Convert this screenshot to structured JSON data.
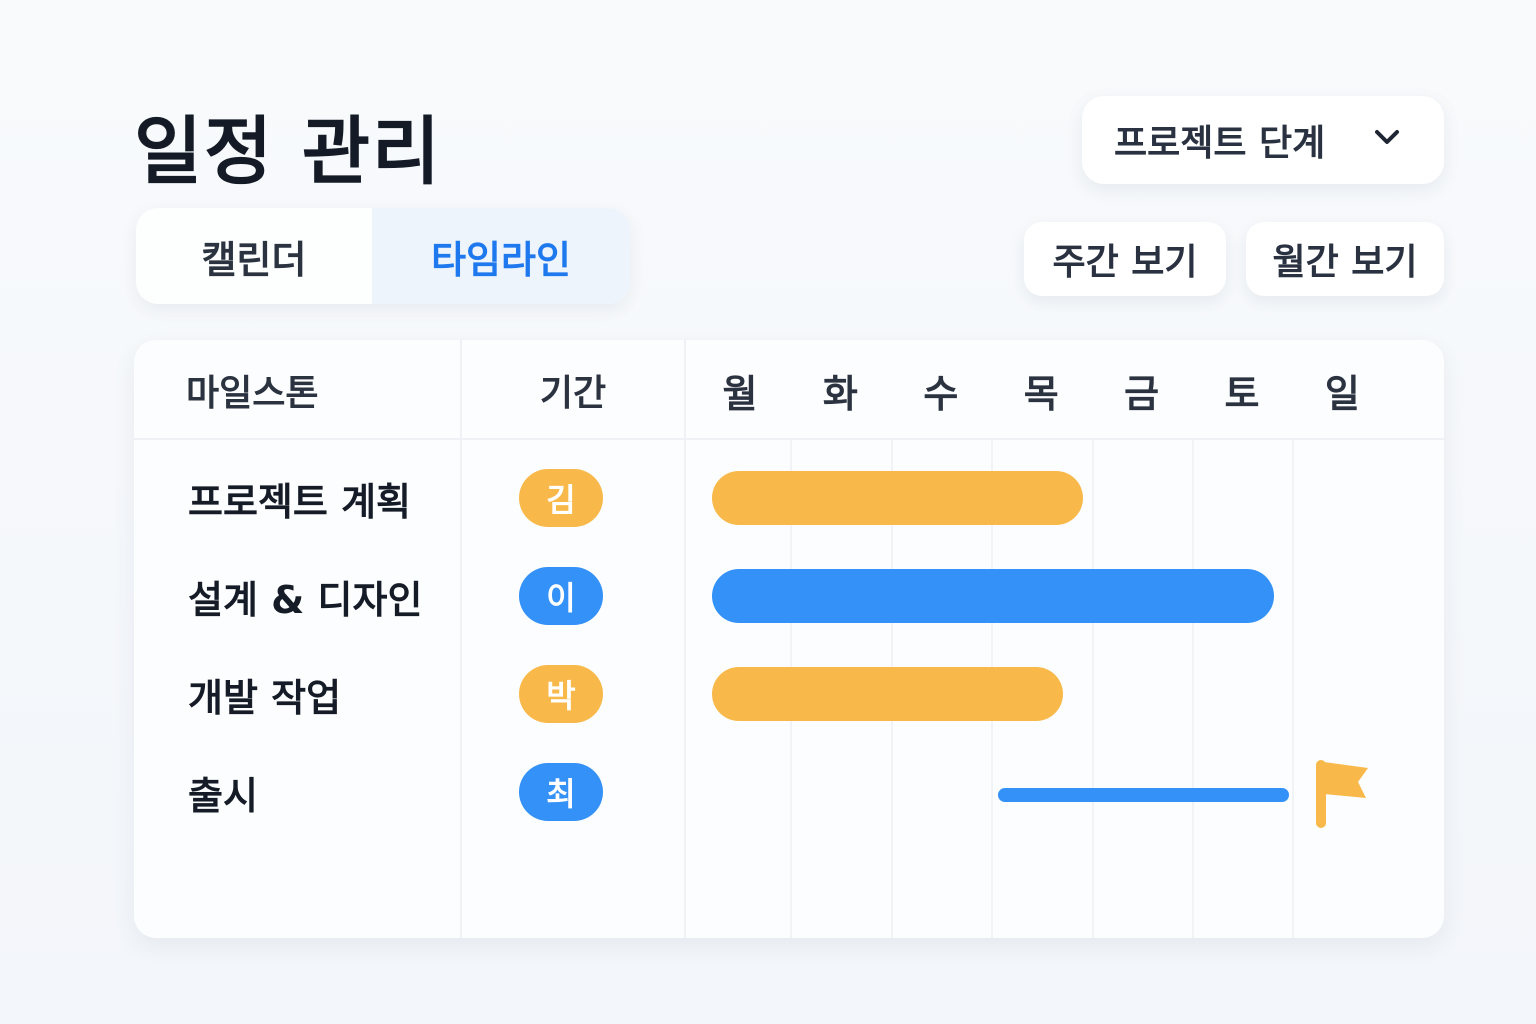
{
  "page": {
    "title": "일정 관리"
  },
  "phase_dropdown": {
    "label": "프로젝트 단계"
  },
  "tabs": [
    {
      "label": "캘린더",
      "active": false
    },
    {
      "label": "타임라인",
      "active": true
    }
  ],
  "view_buttons": {
    "week": "주간 보기",
    "month": "월간 보기"
  },
  "table": {
    "headers": {
      "milestone": "마일스톤",
      "period": "기간"
    },
    "days": [
      "월",
      "화",
      "수",
      "목",
      "금",
      "토",
      "일"
    ],
    "rows": [
      {
        "name": "프로젝트 계획",
        "owner": "김",
        "owner_color": "#f8b94a",
        "bar_color": "#f8b94a",
        "start_day": 0,
        "end_day": 3.7,
        "style": "bar"
      },
      {
        "name": "설계 & 디자인",
        "owner": "이",
        "owner_color": "#3391f7",
        "bar_color": "#3391f7",
        "start_day": 0,
        "end_day": 5.6,
        "style": "bar"
      },
      {
        "name": "개발 작업",
        "owner": "박",
        "owner_color": "#f8b94a",
        "bar_color": "#f8b94a",
        "start_day": 0,
        "end_day": 3.5,
        "style": "bar"
      },
      {
        "name": "출시",
        "owner": "최",
        "owner_color": "#3391f7",
        "bar_color": "#3391f7",
        "start_day": 2.85,
        "end_day": 5.75,
        "style": "line",
        "milestone_flag_color": "#f8b94a"
      }
    ]
  },
  "colors": {
    "accent_blue": "#1e78ee",
    "yellow": "#f8b94a",
    "blue": "#3391f7"
  }
}
